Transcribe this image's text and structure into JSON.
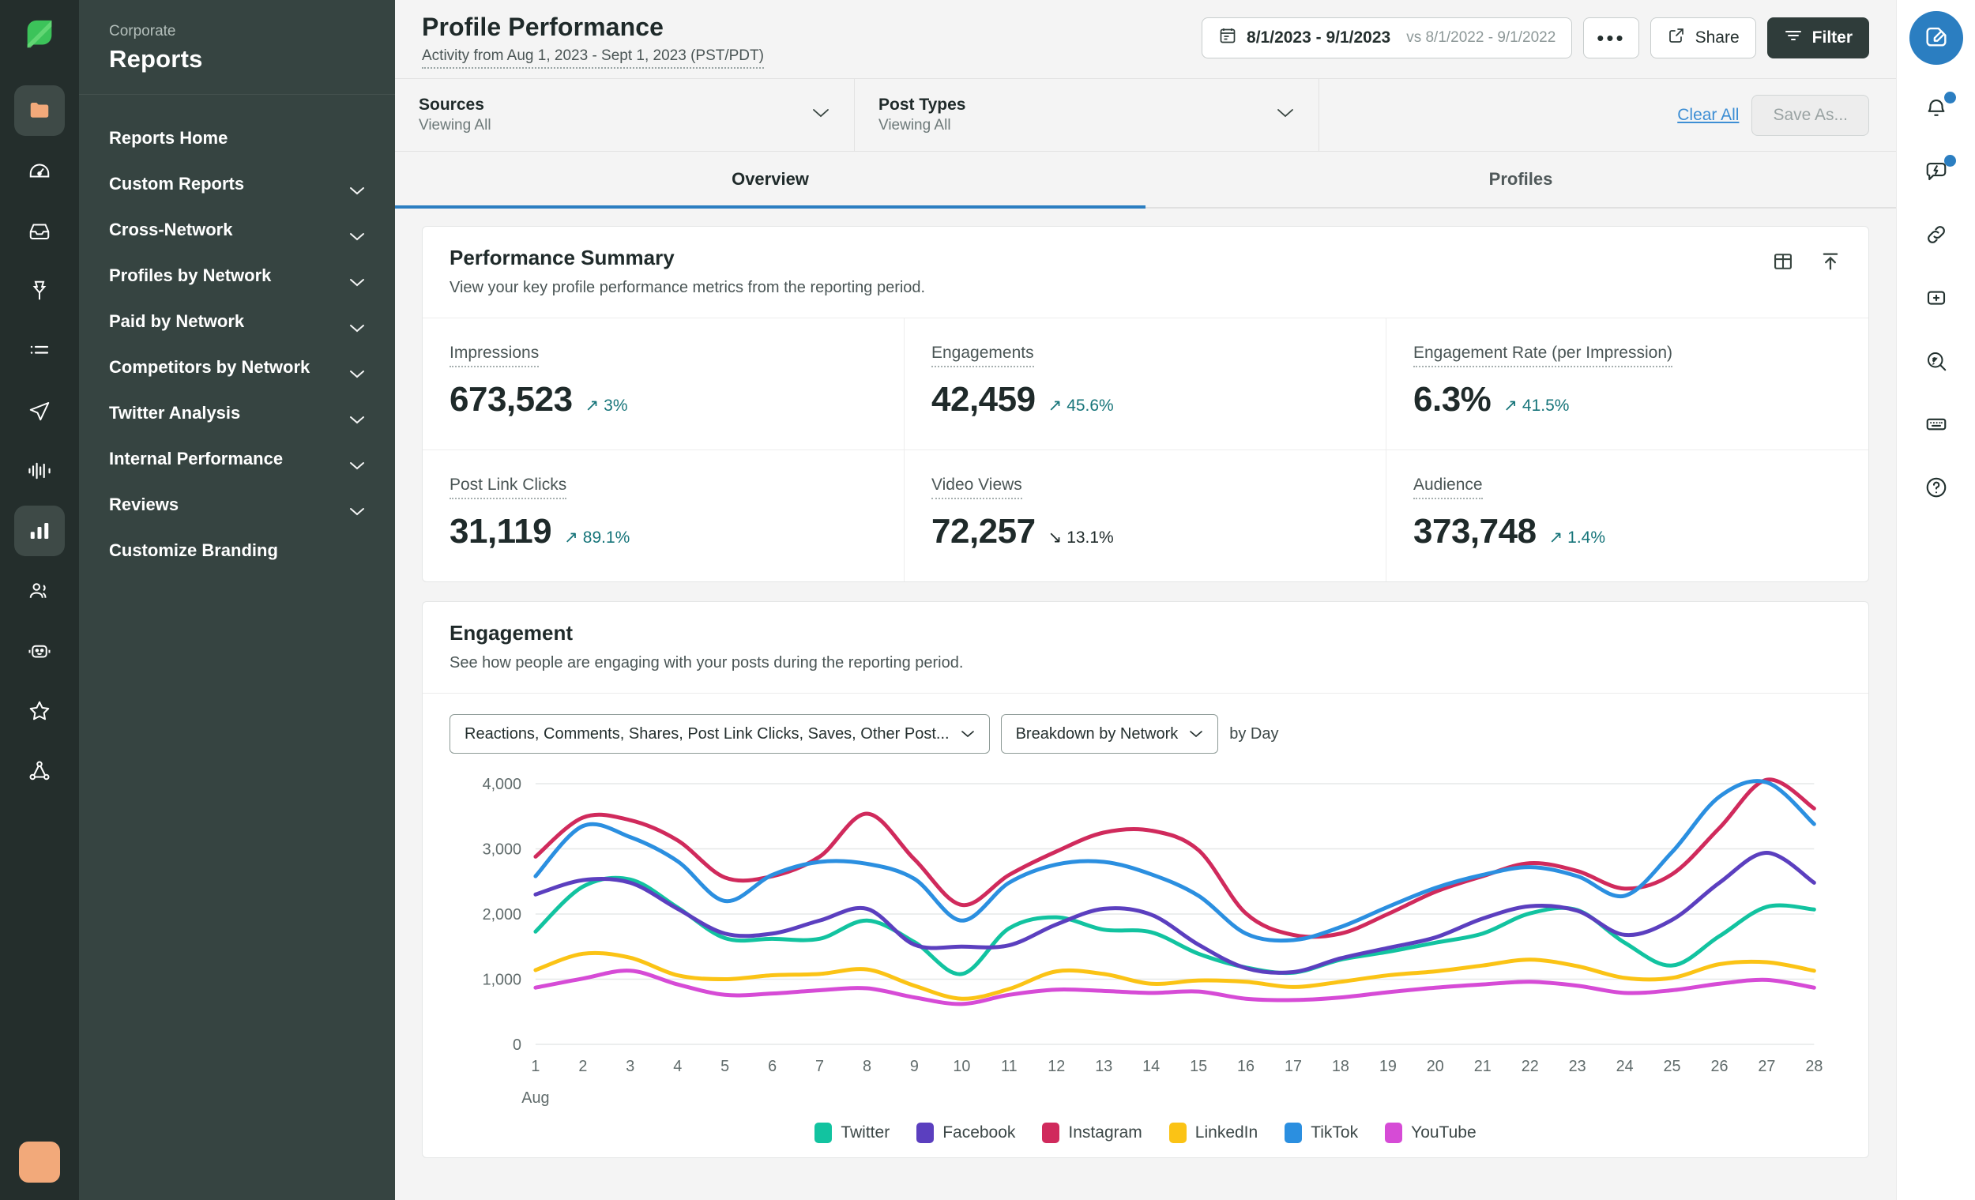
{
  "brand": {
    "logo_icon": "sprout-leaf-logo",
    "accent": "#2b7ec1",
    "sidebar_bg": "#364441",
    "rail_bg": "#242e2c"
  },
  "rail": {
    "items": [
      {
        "icon": "folder-icon",
        "name": "folder",
        "active": true
      },
      {
        "icon": "dashboard-gauge-icon",
        "name": "dashboard",
        "active": false
      },
      {
        "icon": "inbox-icon",
        "name": "inbox",
        "active": false
      },
      {
        "icon": "pin-icon",
        "name": "publishing",
        "active": false
      },
      {
        "icon": "list-icon",
        "name": "tasks",
        "active": false
      },
      {
        "icon": "paper-plane-icon",
        "name": "send",
        "active": false
      },
      {
        "icon": "listening-waveform-icon",
        "name": "listening",
        "active": false
      },
      {
        "icon": "bar-chart-icon",
        "name": "reports",
        "active": true
      },
      {
        "icon": "people-icon",
        "name": "audience",
        "active": false
      },
      {
        "icon": "bot-icon",
        "name": "bots",
        "active": false
      },
      {
        "icon": "star-icon",
        "name": "reviews",
        "active": false
      },
      {
        "icon": "network-nodes-icon",
        "name": "employee-advocacy",
        "active": false
      }
    ],
    "avatar": "user-avatar"
  },
  "sidebar": {
    "eyebrow": "Corporate",
    "title": "Reports",
    "items": [
      {
        "label": "Reports Home",
        "expandable": false
      },
      {
        "label": "Custom Reports",
        "expandable": true
      },
      {
        "label": "Cross-Network",
        "expandable": true
      },
      {
        "label": "Profiles by Network",
        "expandable": true
      },
      {
        "label": "Paid by Network",
        "expandable": true
      },
      {
        "label": "Competitors by Network",
        "expandable": true
      },
      {
        "label": "Twitter Analysis",
        "expandable": true
      },
      {
        "label": "Internal Performance",
        "expandable": true
      },
      {
        "label": "Reviews",
        "expandable": true
      },
      {
        "label": "Customize Branding",
        "expandable": false
      }
    ]
  },
  "header": {
    "title": "Profile Performance",
    "subtitle": "Activity from Aug 1, 2023 - Sept 1, 2023 (PST/PDT)",
    "date_range": "8/1/2023 - 9/1/2023",
    "date_compare": "vs 8/1/2022 - 9/1/2022",
    "more_label": "•••",
    "share_label": "Share",
    "filter_label": "Filter"
  },
  "filters": {
    "sources": {
      "label": "Sources",
      "value": "Viewing All"
    },
    "post_types": {
      "label": "Post Types",
      "value": "Viewing All"
    },
    "clear_all": "Clear All",
    "save_as": "Save As..."
  },
  "tabs": [
    {
      "label": "Overview",
      "active": true
    },
    {
      "label": "Profiles",
      "active": false
    }
  ],
  "summary": {
    "title": "Performance Summary",
    "description": "View your key profile performance metrics from the reporting period.",
    "tools": [
      {
        "icon": "table-view-icon",
        "name": "table-view"
      },
      {
        "icon": "export-up-icon",
        "name": "export"
      }
    ],
    "metrics": [
      {
        "label": "Impressions",
        "value": "673,523",
        "delta": "3%",
        "direction": "up"
      },
      {
        "label": "Engagements",
        "value": "42,459",
        "delta": "45.6%",
        "direction": "up"
      },
      {
        "label": "Engagement Rate (per Impression)",
        "value": "6.3%",
        "delta": "41.5%",
        "direction": "up"
      },
      {
        "label": "Post Link Clicks",
        "value": "31,119",
        "delta": "89.1%",
        "direction": "up"
      },
      {
        "label": "Video Views",
        "value": "72,257",
        "delta": "13.1%",
        "direction": "down"
      },
      {
        "label": "Audience",
        "value": "373,748",
        "delta": "1.4%",
        "direction": "up"
      }
    ]
  },
  "engagement": {
    "title": "Engagement",
    "description": "See how people are engaging with your posts during the reporting period.",
    "metric_select": "Reactions, Comments, Shares, Post Link Clicks, Saves, Other Post...",
    "breakdown_select": "Breakdown by Network",
    "interval_label": "by Day"
  },
  "chart_data": {
    "type": "line",
    "title": "Engagement",
    "xlabel": "Aug",
    "ylabel": "",
    "ylim": [
      0,
      4000
    ],
    "yticks": [
      0,
      1000,
      2000,
      3000,
      4000
    ],
    "ytick_labels": [
      "0",
      "1,000",
      "2,000",
      "3,000",
      "4,000"
    ],
    "grid": true,
    "legend_position": "bottom",
    "month_label": "Aug",
    "x": [
      1,
      2,
      3,
      4,
      5,
      6,
      7,
      8,
      9,
      10,
      11,
      12,
      13,
      14,
      15,
      16,
      17,
      18,
      19,
      20,
      21,
      22,
      23,
      24,
      25,
      26,
      27,
      28
    ],
    "xtick_labels": [
      "1",
      "2",
      "3",
      "4",
      "5",
      "6",
      "7",
      "8",
      "9",
      "10",
      "11",
      "12",
      "13",
      "14",
      "15",
      "16",
      "17",
      "18",
      "19",
      "20",
      "21",
      "22",
      "23",
      "24",
      "25",
      "26",
      "27",
      "28"
    ],
    "series": [
      {
        "name": "Twitter",
        "color": "#12c3a0",
        "values": [
          1730,
          2420,
          2530,
          2100,
          1630,
          1620,
          1620,
          1900,
          1570,
          1080,
          1780,
          1950,
          1760,
          1720,
          1390,
          1180,
          1100,
          1300,
          1420,
          1560,
          1700,
          2010,
          2060,
          1560,
          1210,
          1660,
          2110,
          2070
        ]
      },
      {
        "name": "Facebook",
        "color": "#5b3fbf",
        "values": [
          2300,
          2520,
          2480,
          2080,
          1700,
          1700,
          1900,
          2080,
          1530,
          1500,
          1520,
          1840,
          2080,
          1990,
          1530,
          1170,
          1110,
          1320,
          1480,
          1640,
          1930,
          2120,
          2050,
          1680,
          1910,
          2480,
          2940,
          2480
        ]
      },
      {
        "name": "Instagram",
        "color": "#d02a5c",
        "values": [
          2880,
          3480,
          3440,
          3130,
          2560,
          2580,
          2880,
          3540,
          2840,
          2140,
          2600,
          2960,
          3250,
          3280,
          2980,
          2010,
          1680,
          1700,
          2000,
          2340,
          2580,
          2780,
          2660,
          2390,
          2610,
          3320,
          4060,
          3620
        ]
      },
      {
        "name": "LinkedIn",
        "color": "#fbc315",
        "values": [
          1140,
          1390,
          1330,
          1060,
          1000,
          1060,
          1080,
          1150,
          900,
          700,
          850,
          1120,
          1080,
          930,
          980,
          960,
          880,
          960,
          1060,
          1120,
          1210,
          1300,
          1200,
          1020,
          1020,
          1230,
          1260,
          1130
        ]
      },
      {
        "name": "TikTok",
        "color": "#2b8fe0",
        "values": [
          2580,
          3350,
          3180,
          2810,
          2200,
          2600,
          2800,
          2770,
          2540,
          1900,
          2480,
          2760,
          2800,
          2610,
          2280,
          1700,
          1600,
          1800,
          2110,
          2400,
          2600,
          2720,
          2580,
          2280,
          2950,
          3800,
          4020,
          3380
        ]
      },
      {
        "name": "YouTube",
        "color": "#d64bd6",
        "values": [
          870,
          1010,
          1130,
          920,
          760,
          780,
          830,
          860,
          720,
          620,
          760,
          840,
          820,
          790,
          810,
          700,
          680,
          720,
          800,
          870,
          920,
          960,
          900,
          790,
          830,
          930,
          990,
          870
        ]
      }
    ]
  }
}
